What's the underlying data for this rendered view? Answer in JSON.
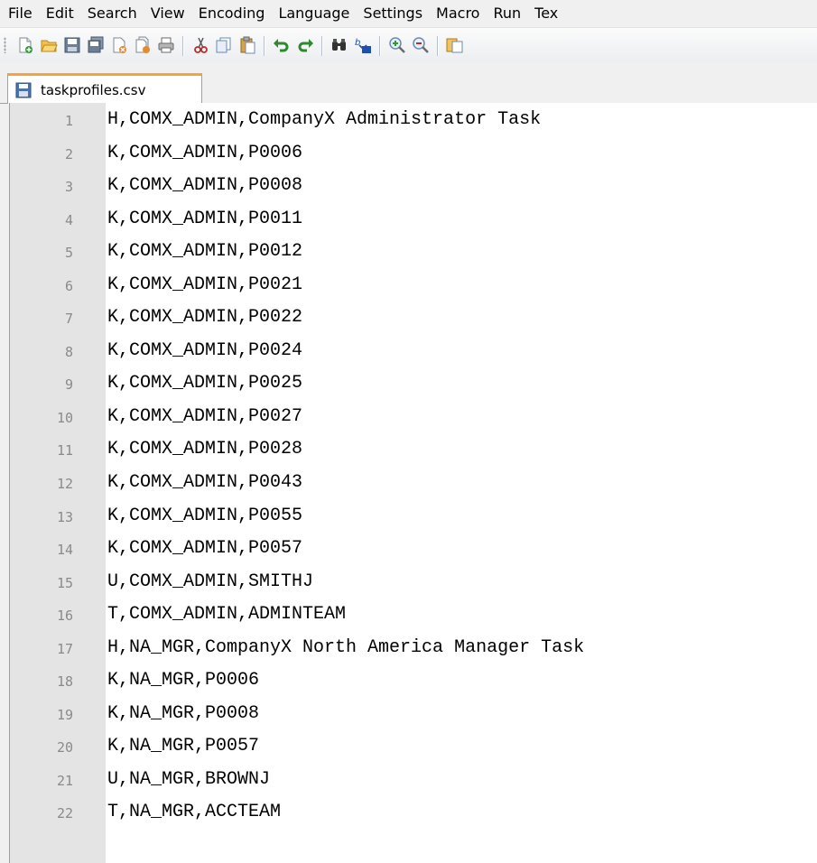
{
  "menu": [
    "File",
    "Edit",
    "Search",
    "View",
    "Encoding",
    "Language",
    "Settings",
    "Macro",
    "Run",
    "Tex"
  ],
  "toolbar_icons": [
    "new-file-icon",
    "open-file-icon",
    "save-icon",
    "save-all-icon",
    "close-icon",
    "close-all-icon",
    "print-icon",
    "cut-icon",
    "copy-icon",
    "paste-icon",
    "undo-icon",
    "redo-icon",
    "find-icon",
    "replace-icon",
    "zoom-in-icon",
    "zoom-out-icon",
    "sync-scroll-icon"
  ],
  "tab": {
    "label": "taskprofiles.csv",
    "icon": "floppy-disk-icon",
    "accent": "#f8a337"
  },
  "lines": [
    {
      "n": "1",
      "text": "H,COMX_ADMIN,CompanyX Administrator Task"
    },
    {
      "n": "2",
      "text": "K,COMX_ADMIN,P0006"
    },
    {
      "n": "3",
      "text": "K,COMX_ADMIN,P0008"
    },
    {
      "n": "4",
      "text": "K,COMX_ADMIN,P0011"
    },
    {
      "n": "5",
      "text": "K,COMX_ADMIN,P0012"
    },
    {
      "n": "6",
      "text": "K,COMX_ADMIN,P0021"
    },
    {
      "n": "7",
      "text": "K,COMX_ADMIN,P0022"
    },
    {
      "n": "8",
      "text": "K,COMX_ADMIN,P0024"
    },
    {
      "n": "9",
      "text": "K,COMX_ADMIN,P0025"
    },
    {
      "n": "10",
      "text": "K,COMX_ADMIN,P0027"
    },
    {
      "n": "11",
      "text": "K,COMX_ADMIN,P0028"
    },
    {
      "n": "12",
      "text": "K,COMX_ADMIN,P0043"
    },
    {
      "n": "13",
      "text": "K,COMX_ADMIN,P0055"
    },
    {
      "n": "14",
      "text": "K,COMX_ADMIN,P0057"
    },
    {
      "n": "15",
      "text": "U,COMX_ADMIN,SMITHJ"
    },
    {
      "n": "16",
      "text": "T,COMX_ADMIN,ADMINTEAM"
    },
    {
      "n": "17",
      "text": "H,NA_MGR,CompanyX North America Manager Task"
    },
    {
      "n": "18",
      "text": "K,NA_MGR,P0006"
    },
    {
      "n": "19",
      "text": "K,NA_MGR,P0008"
    },
    {
      "n": "20",
      "text": "K,NA_MGR,P0057"
    },
    {
      "n": "21",
      "text": "U,NA_MGR,BROWNJ"
    },
    {
      "n": "22",
      "text": "T,NA_MGR,ACCTEAM"
    }
  ]
}
